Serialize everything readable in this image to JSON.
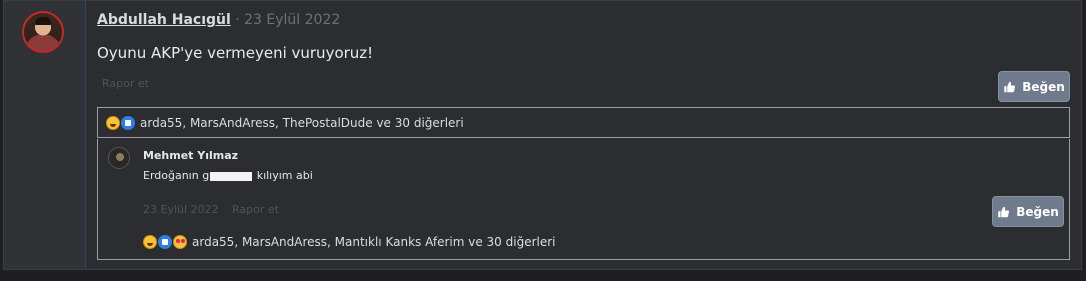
{
  "post": {
    "author": "Abdullah Hacıgül",
    "separator": "·",
    "date": "23 Eylül 2022",
    "message": "Oyunu AKP'ye vermeyeni vuruyoruz!",
    "report_label": "Rapor et",
    "like_label": "Beğen",
    "reactions_text": "arda55, MarsAndAress, ThePostalDude ve 30 diğerleri"
  },
  "reply": {
    "author": "Mehmet Yılmaz",
    "text_before": "Erdoğanın g",
    "text_after": " kılıyım abi",
    "date": "23 Eylül 2022",
    "report_label": "Rapor et",
    "like_label": "Beğen",
    "reactions_text": "arda55, MarsAndAress, Mantıklı Kanks Aferim ve 30 diğerleri"
  },
  "colors": {
    "like_button": "#6f7b8d",
    "avatar_ring": "#c62828"
  }
}
